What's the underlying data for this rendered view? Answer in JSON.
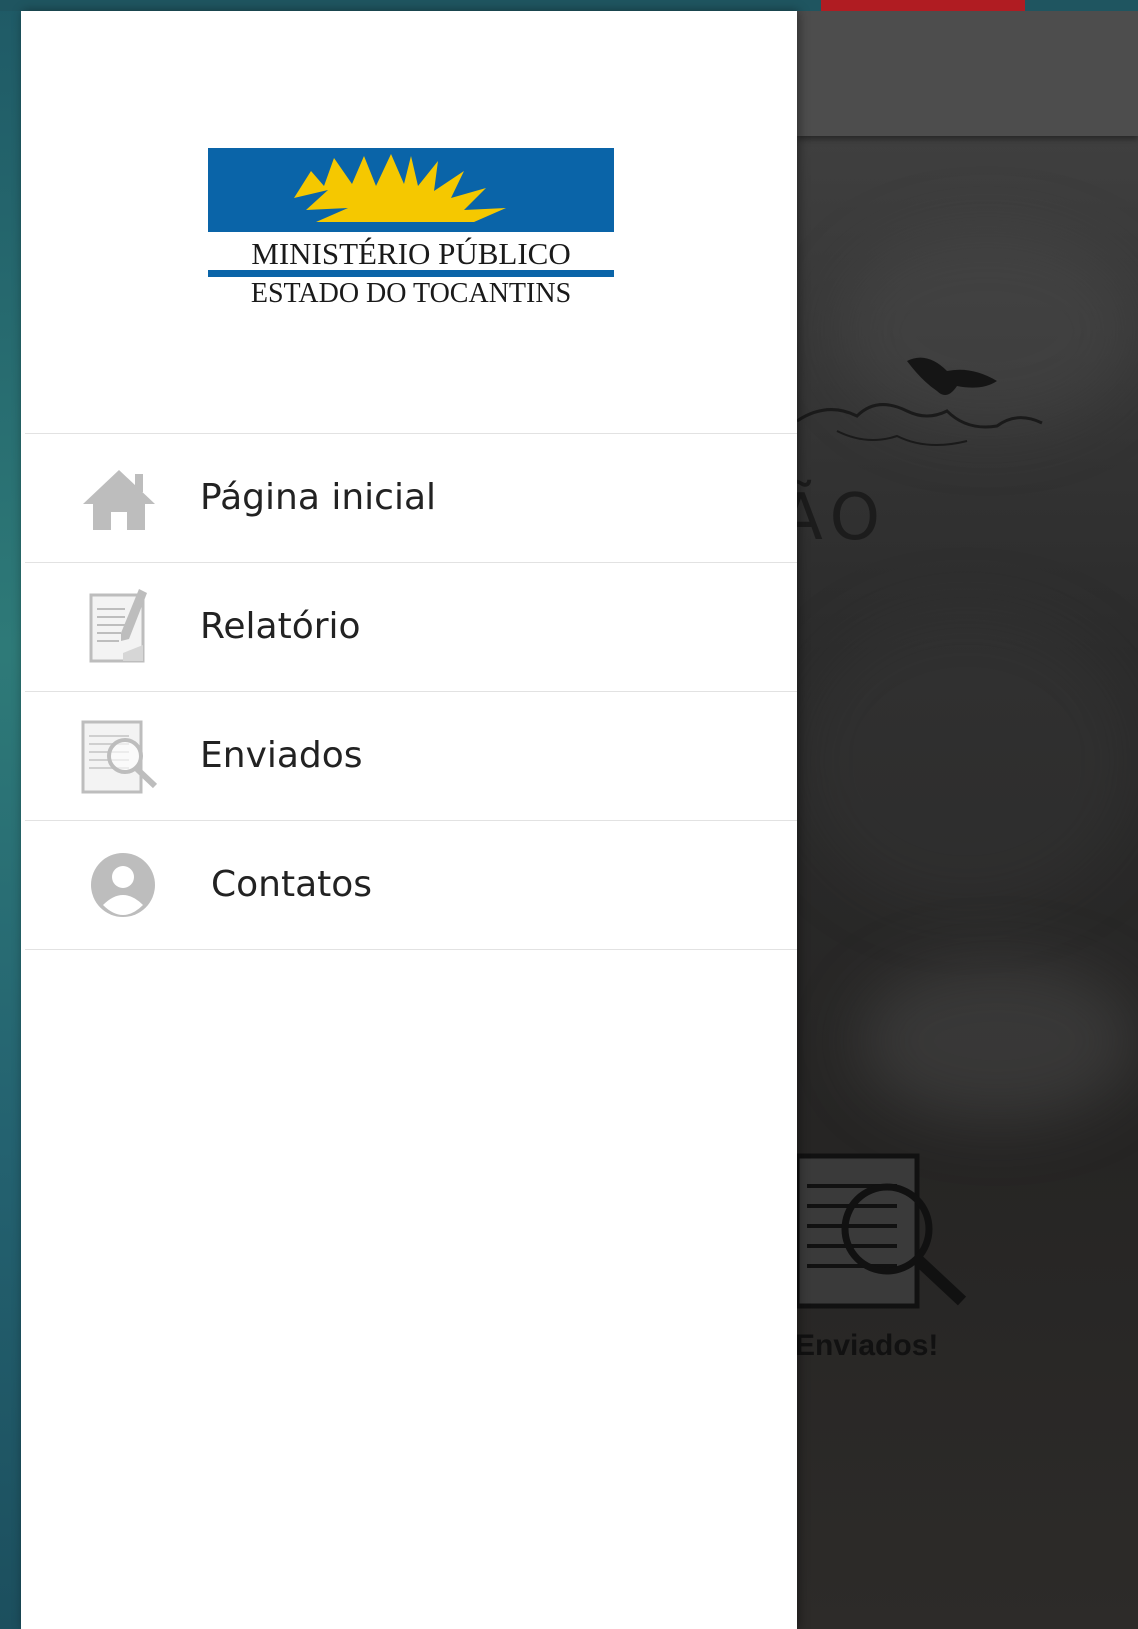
{
  "logo": {
    "line1": "MINISTÉRIO PÚBLICO",
    "line2": "ESTADO DO TOCANTINS"
  },
  "menu": {
    "items": [
      {
        "label": "Página inicial",
        "icon": "home-icon"
      },
      {
        "label": "Relatório",
        "icon": "edit-document-icon"
      },
      {
        "label": "Enviados",
        "icon": "document-search-icon"
      },
      {
        "label": "Contatos",
        "icon": "user-circle-icon"
      }
    ]
  },
  "background": {
    "title_fragment": "ÃO",
    "button_label": "Enviados!"
  },
  "colors": {
    "logo_blue": "#0a64a8",
    "logo_sun": "#f5c800",
    "accent_red": "#b01c22",
    "icon_gray": "#bdbdbd"
  }
}
